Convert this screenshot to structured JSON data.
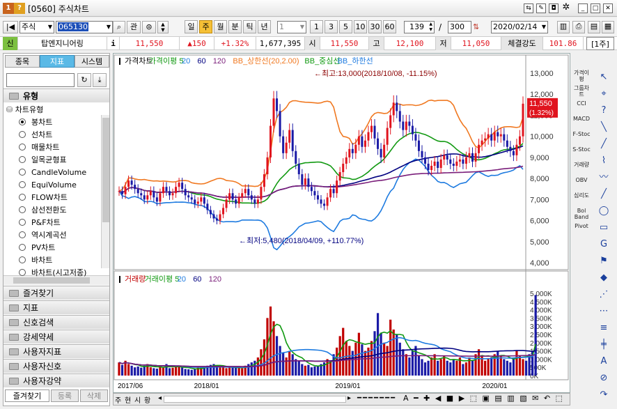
{
  "window": {
    "title": "[0560] 주식차트",
    "icon_label": "1",
    "help_label": "?"
  },
  "toolbar": {
    "market_select": "주식",
    "code_input": "065130",
    "search_icon": "search-icon",
    "gwan_label": "관",
    "periods": [
      "일",
      "주",
      "월",
      "분",
      "틱",
      "년"
    ],
    "active_period": "주",
    "interval_select": "1",
    "interval_buttons": [
      "1",
      "3",
      "5",
      "10",
      "30",
      "60"
    ],
    "count_value": "139",
    "count_total": "300",
    "date_value": "2020/02/14"
  },
  "quote": {
    "shin_label": "신",
    "name": "탑엔지니어링",
    "info_label": "i",
    "price": "11,550",
    "change": "150",
    "change_pct": "+1.32%",
    "volume": "1,677,395",
    "open_label": "시",
    "open": "11,550",
    "high_label": "고",
    "high": "12,100",
    "low_label": "저",
    "low": "11,050",
    "strength_label": "체결강도",
    "strength": "101.86",
    "unit_label": "[1주]"
  },
  "left_panel": {
    "tabs": [
      "종목",
      "지표",
      "시스템"
    ],
    "active_tab": "지표",
    "section_title": "유형",
    "tree_root": "차트유형",
    "chart_types": [
      "봉차트",
      "선차트",
      "매물차트",
      "일목균형표",
      "CandleVolume",
      "EquiVolume",
      "FLOW차트",
      "삼선전환도",
      "P&F차트",
      "역시계곡선",
      "PV차트",
      "바차트",
      "바차트(시고저종)"
    ],
    "selected_type": "봉차트",
    "folders": [
      "즐겨찾기",
      "지표",
      "신호검색",
      "강세약세",
      "사용자지표",
      "사용자신호",
      "사용자강약"
    ],
    "bottom_tabs": [
      "즐겨찾기",
      "등록",
      "삭제"
    ]
  },
  "chart": {
    "price_legend": [
      {
        "label": "가격차트",
        "color": "#000000"
      },
      {
        "label": "가격이평 5",
        "color": "#119911"
      },
      {
        "label": "20",
        "color": "#1e7be0"
      },
      {
        "label": "60",
        "color": "#000080"
      },
      {
        "label": "120",
        "color": "#7a1e7a"
      },
      {
        "label": "BB_상한선(20,2.00)",
        "color": "#f07820"
      },
      {
        "label": "BB_중심선",
        "color": "#119911"
      },
      {
        "label": "BB_하한선",
        "color": "#1e7be0"
      }
    ],
    "volume_legend": [
      {
        "label": "거래량",
        "color": "#c00000"
      },
      {
        "label": "거래이평 5",
        "color": "#119911"
      },
      {
        "label": "20",
        "color": "#1e7be0"
      },
      {
        "label": "60",
        "color": "#000080"
      },
      {
        "label": "120",
        "color": "#7a1e7a"
      }
    ],
    "max_annotation": "←최고:13,000(2018/10/08, -11.15%)",
    "min_annotation": "←최저:5,480(2018/04/09, +110.77%)",
    "current_price_tag": "11,550",
    "current_pct_tag": "(1.32%)",
    "price_axis": [
      "13,000",
      "12,000",
      "11,000",
      "10,000",
      "9,000",
      "8,000",
      "7,000",
      "6,000",
      "5,000",
      "4,000"
    ],
    "volume_axis": [
      "5,000K",
      "4,500K",
      "4,000K",
      "3,500K",
      "3,000K",
      "2,500K",
      "2,000K",
      "1,500K",
      "1,000K",
      "500K",
      "0K"
    ],
    "date_axis": [
      "2017/06",
      "2018/01",
      "2019/01",
      "2020/01"
    ],
    "bottom_tabs": [
      "주",
      "현",
      "시",
      "황"
    ]
  },
  "right_tools": [
    "가격이평",
    "그룹차트",
    "CCI",
    "MACD",
    "F-Stoc",
    "S-Stoc",
    "거래량",
    "OBV",
    "심리도",
    "Bol Band",
    "Pivot"
  ],
  "chart_data": {
    "type": "candlestick",
    "x_range": [
      "2017/06",
      "2020/01"
    ],
    "price_ylim": [
      4000,
      13500
    ],
    "volume_ylim": [
      0,
      5000000
    ],
    "max_point": {
      "value": 13000,
      "date": "2018/10/08"
    },
    "min_point": {
      "value": 5480,
      "date": "2018/04/09"
    },
    "last_price": 11550,
    "weekly_close": [
      7400,
      7250,
      7600,
      7900,
      7700,
      7500,
      7300,
      7200,
      7000,
      7200,
      7400,
      7100,
      6900,
      7300,
      7600,
      7400,
      7200,
      7300,
      7600,
      7800,
      7500,
      7200,
      7100,
      7000,
      6800,
      6900,
      7100,
      6800,
      6500,
      6300,
      6100,
      6000,
      6300,
      6600,
      7000,
      7300,
      7000,
      6800,
      7100,
      7300,
      7500,
      7200,
      7000,
      6800,
      7000,
      7600,
      8200,
      9000,
      10500,
      11800,
      11200,
      10000,
      9200,
      9700,
      10300,
      9300,
      8700,
      8200,
      7700,
      8000,
      7600,
      7400,
      7200,
      7000,
      6800,
      6700,
      7100,
      7500,
      7300,
      7900,
      8300,
      8700,
      9000,
      9400,
      9200,
      9600,
      10000,
      9500,
      9800,
      10200,
      10500,
      9900,
      9400,
      9000,
      9600,
      10400,
      11000,
      11600,
      11200,
      10700,
      10300,
      10700,
      10500,
      10100,
      9800,
      9300,
      9000,
      8700,
      8400,
      8600,
      8800,
      8500,
      8900,
      9100,
      8900,
      8700,
      8600,
      8800,
      8900,
      8700,
      9000,
      9200,
      8800,
      9200,
      9600,
      9800,
      9900,
      10100,
      9800,
      10200,
      10000,
      10100,
      9800,
      9500,
      9300,
      9100,
      9600,
      10000,
      11550
    ],
    "weekly_volume": [
      800,
      650,
      900,
      700,
      600,
      500,
      550,
      480,
      600,
      700,
      500,
      450,
      420,
      600,
      500,
      700,
      450,
      480,
      520,
      600,
      500,
      400,
      380,
      350,
      420,
      480,
      500,
      550,
      600,
      650,
      700,
      600,
      550,
      500,
      450,
      520,
      480,
      500,
      460,
      440,
      600,
      700,
      800,
      900,
      1100,
      1600,
      2200,
      3500,
      4200,
      3300,
      2400,
      1800,
      1400,
      1100,
      1500,
      1300,
      1000,
      900,
      700,
      600,
      650,
      500,
      550,
      600,
      700,
      800,
      1000,
      900,
      1300,
      1700,
      2400,
      2900,
      2100,
      1800,
      1500,
      2000,
      2600,
      1900,
      1500,
      1700,
      2100,
      2700,
      3800,
      2600,
      2000,
      1800,
      3400,
      2800,
      2500,
      2000,
      1600,
      1300,
      1100,
      1500,
      1800,
      1200,
      1000,
      800,
      900,
      1100,
      1300,
      900,
      1000,
      1200,
      900,
      800,
      1000,
      900,
      1100,
      700,
      800,
      1100,
      900,
      1300,
      1600,
      1200,
      900,
      1000,
      1100,
      1300,
      1500,
      1200,
      1000,
      900,
      800,
      1100,
      1500,
      1200,
      1000,
      900,
      1300,
      1500,
      4900
    ]
  }
}
